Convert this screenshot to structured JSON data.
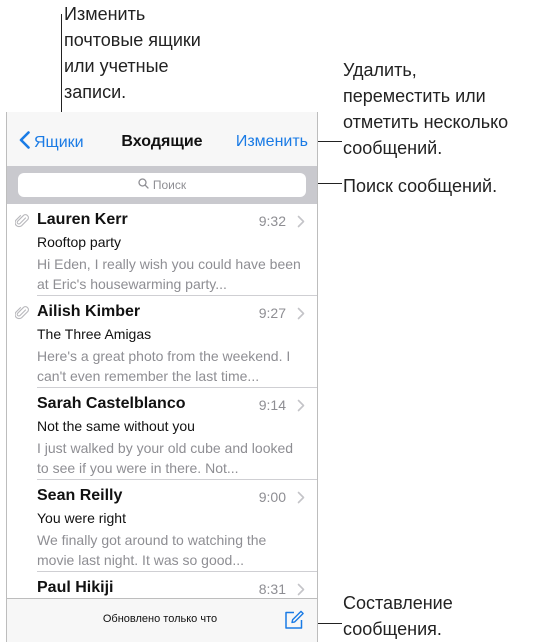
{
  "callouts": {
    "mailboxes": "Изменить\nпочтовые ящики\nили учетные\nзаписи.",
    "edit": "Удалить,\nпереместить или\nотметить несколько\nсообщений.",
    "search": "Поиск сообщений.",
    "compose": "Составление\nсообщения."
  },
  "nav": {
    "back_label": "Ящики",
    "title": "Входящие",
    "edit_label": "Изменить"
  },
  "search": {
    "placeholder": "Поиск"
  },
  "messages": [
    {
      "sender": "Lauren Kerr",
      "time": "9:32",
      "subject": "Rooftop party",
      "preview": "Hi Eden, I really wish you could have been at Eric's housewarming party...",
      "attachment": true
    },
    {
      "sender": "Ailish Kimber",
      "time": "9:27",
      "subject": "The Three Amigas",
      "preview": "Here's a great photo from the weekend. I can't even remember the last time...",
      "attachment": true
    },
    {
      "sender": "Sarah Castelblanco",
      "time": "9:14",
      "subject": "Not the same without you",
      "preview": "I just walked by your old cube and looked to see if you were in there. Not...",
      "attachment": false
    },
    {
      "sender": "Sean Reilly",
      "time": "9:00",
      "subject": "You were right",
      "preview": "We finally got around to watching the movie last night. It was so good...",
      "attachment": false
    },
    {
      "sender": "Paul Hikiji",
      "time": "8:31",
      "subject": "",
      "preview": "",
      "attachment": false
    }
  ],
  "toolbar": {
    "status": "Обновлено только что"
  },
  "icons": {
    "back": "chevron-left-icon",
    "search": "search-icon",
    "attachment": "paperclip-icon",
    "disclosure": "chevron-right-icon",
    "compose": "compose-icon"
  },
  "colors": {
    "accent": "#1a7be5",
    "secondary_text": "#8e8e93",
    "search_bar_bg": "#c9c9ce"
  }
}
